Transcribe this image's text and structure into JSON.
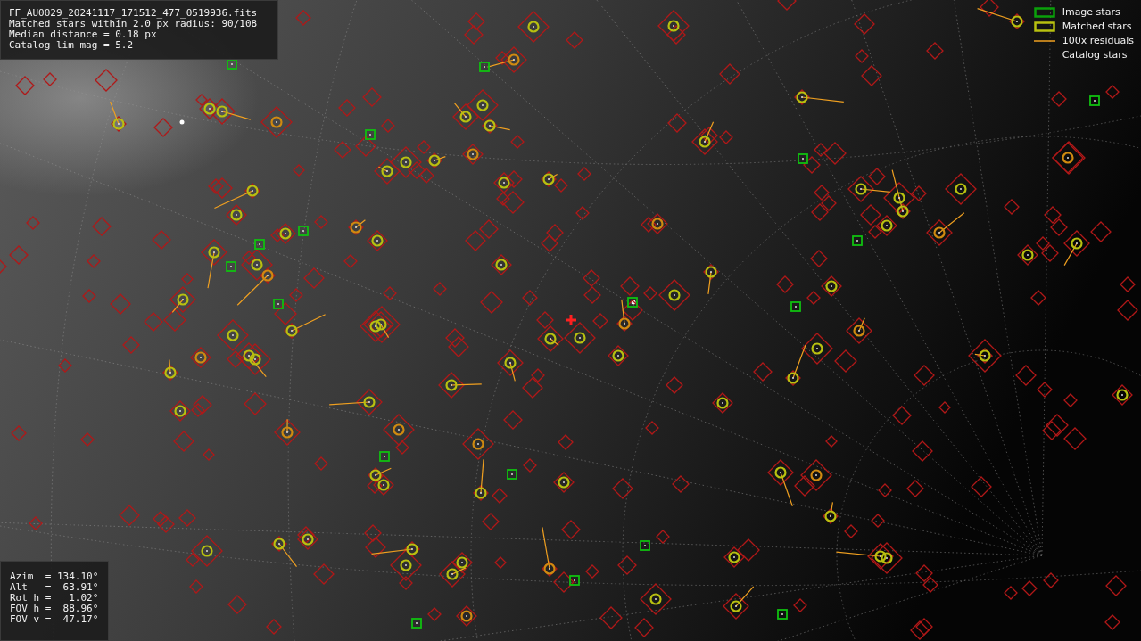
{
  "info_box": {
    "lines": [
      "FF_AU0029_20241117_171512_477_0519936.fits",
      "Matched stars within 2.0 px radius: 90/108",
      "Median distance = 0.18 px",
      "Catalog lim mag = 5.2"
    ]
  },
  "legend": [
    {
      "kind": "image",
      "label": "Image stars"
    },
    {
      "kind": "matched",
      "label": "Matched stars"
    },
    {
      "kind": "residual",
      "label": "100x residuals"
    },
    {
      "kind": "catalog",
      "label": "Catalog stars"
    }
  ],
  "pointing_box": {
    "lines": [
      "Azim  = 134.10°",
      "Alt   =  63.91°",
      "Rot h =   1.02°",
      "FOV h =  88.96°",
      "FOV v =  47.17°"
    ]
  }
}
